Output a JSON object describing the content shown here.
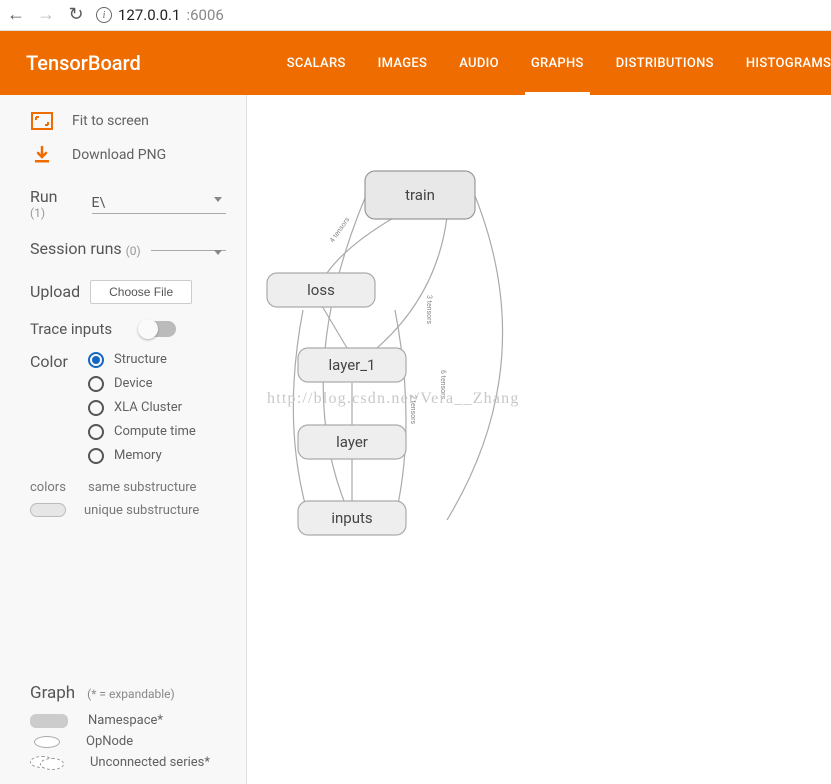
{
  "browser": {
    "url_host": "127.0.0.1",
    "url_port": ":6006"
  },
  "header": {
    "title": "TensorBoard",
    "tabs": [
      {
        "label": "SCALARS",
        "active": false
      },
      {
        "label": "IMAGES",
        "active": false
      },
      {
        "label": "AUDIO",
        "active": false
      },
      {
        "label": "GRAPHS",
        "active": true
      },
      {
        "label": "DISTRIBUTIONS",
        "active": false
      },
      {
        "label": "HISTOGRAMS",
        "active": false
      }
    ]
  },
  "sidebar": {
    "fit_label": "Fit to screen",
    "download_label": "Download PNG",
    "run": {
      "label": "Run",
      "count": "(1)",
      "value": "E\\"
    },
    "session": {
      "label": "Session runs",
      "count": "(0)",
      "value": ""
    },
    "upload": {
      "label": "Upload",
      "button": "Choose File"
    },
    "trace_label": "Trace inputs",
    "color": {
      "label": "Color",
      "options": [
        "Structure",
        "Device",
        "XLA Cluster",
        "Compute time",
        "Memory"
      ],
      "selected": 0
    },
    "colors_word": "colors",
    "legend_same": "same substructure",
    "legend_unique": "unique substructure",
    "graph_legend": {
      "title": "Graph",
      "subtitle": "(* = expandable)",
      "namespace": "Namespace*",
      "opnode": "OpNode",
      "unconnected": "Unconnected series*"
    }
  },
  "graph": {
    "nodes": {
      "train": "train",
      "loss": "loss",
      "layer1": "layer_1",
      "layer": "layer",
      "inputs": "inputs"
    },
    "edge_labels": {
      "train_loss": "4 tensors",
      "train_layer1": "3 tensors",
      "train_layer": "6 tensors",
      "layer1_layer": "2 tensors"
    }
  },
  "watermark": "http://blog.csdn.net/Vera__Zhang"
}
